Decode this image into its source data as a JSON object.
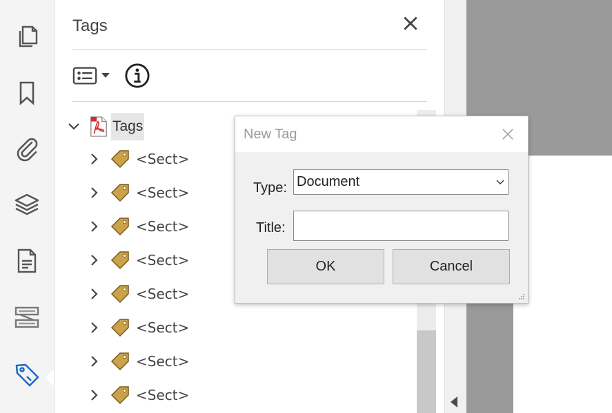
{
  "panel": {
    "title": "Tags",
    "tree": {
      "root_label": "Tags",
      "items": [
        "<Sect>",
        "<Sect>",
        "<Sect>",
        "<Sect>",
        "<Sect>",
        "<Sect>",
        "<Sect>",
        "<Sect>"
      ]
    }
  },
  "rail": {
    "icons": [
      "pages-icon",
      "bookmark-icon",
      "attachment-icon",
      "layers-icon",
      "document-icon",
      "content-icon",
      "tag-icon"
    ],
    "active": "tag-icon"
  },
  "dialog": {
    "title": "New Tag",
    "type_label": "Type:",
    "type_value": "Document",
    "title_label": "Title:",
    "title_value": "",
    "ok_label": "OK",
    "cancel_label": "Cancel"
  },
  "colors": {
    "accent": "#1b6ac9",
    "tag_gold": "#c9a24a",
    "pdf_red": "#d22b2b"
  }
}
